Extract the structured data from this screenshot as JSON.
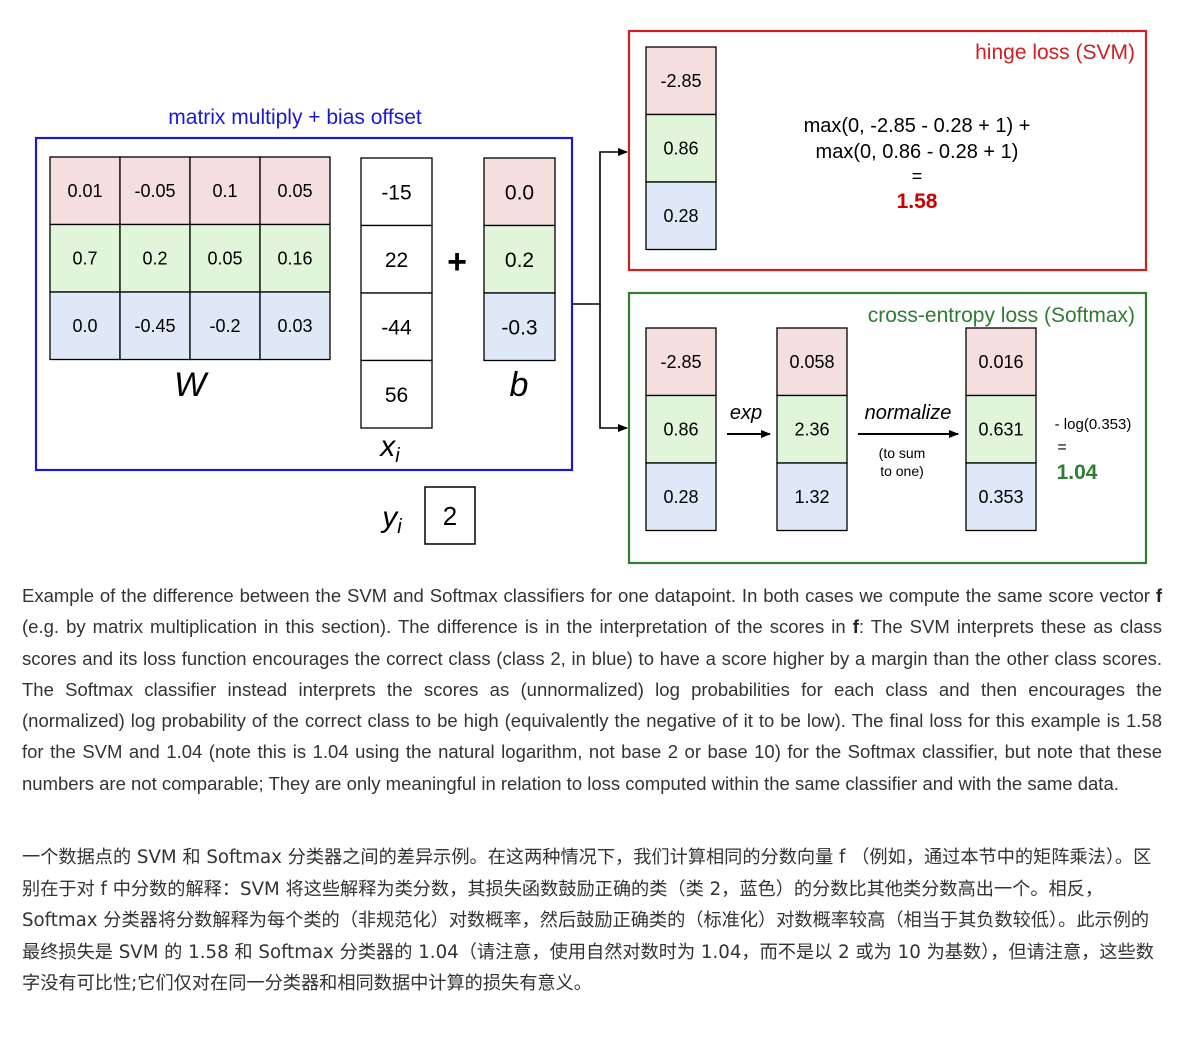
{
  "colors": {
    "row_red": "#f4dfde",
    "row_green": "#e0f5da",
    "row_blue": "#dfe8f7",
    "matrix_box": "#1a1ad6",
    "svm_box": "#d01e23",
    "softmax_box": "#2e7d32",
    "svm_result": "#cc0000",
    "softmax_result": "#2e7d32",
    "label_blue": "#1a1ad6",
    "label_red": "#d01e23",
    "label_green": "#2e7d32"
  },
  "matrix": {
    "label": "matrix multiply + bias offset",
    "W": [
      [
        "0.01",
        "-0.05",
        "0.1",
        "0.05"
      ],
      [
        "0.7",
        "0.2",
        "0.05",
        "0.16"
      ],
      [
        "0.0",
        "-0.45",
        "-0.2",
        "0.03"
      ]
    ],
    "W_label": "W",
    "x": [
      "-15",
      "22",
      "-44",
      "56"
    ],
    "x_label": "x",
    "x_sub": "i",
    "plus": "+",
    "b": [
      "0.0",
      "0.2",
      "-0.3"
    ],
    "b_label": "b",
    "y_label": "y",
    "y_sub": "i",
    "y_value": "2"
  },
  "svm": {
    "title": "hinge loss (SVM)",
    "scores": [
      "-2.85",
      "0.86",
      "0.28"
    ],
    "line1": "max(0, -2.85 - 0.28 + 1) +",
    "line2": "max(0, 0.86 - 0.28 + 1)",
    "equals": "=",
    "result": "1.58"
  },
  "softmax": {
    "title": "cross-entropy loss (Softmax)",
    "scores": [
      "-2.85",
      "0.86",
      "0.28"
    ],
    "exp_label": "exp",
    "exp_scores": [
      "0.058",
      "2.36",
      "1.32"
    ],
    "normalize_label": "normalize",
    "normalize_note1": "(to sum",
    "normalize_note2": "to one)",
    "probs": [
      "0.016",
      "0.631",
      "0.353"
    ],
    "loss_expr": "- log(0.353)",
    "equals": "=",
    "result": "1.04"
  },
  "caption_en": {
    "p1": "Example of the difference between the SVM and Softmax classifiers for one datapoint. In both cases we compute the same score vector ",
    "f1": "f",
    "p2": " (e.g. by matrix multiplication in this section). The difference is in the interpretation of the scores in ",
    "f2": "f",
    "p3": ": The SVM interprets these as class scores and its loss function encourages the correct class (class 2, in blue) to have a score higher by a margin than the other class scores. The Softmax classifier instead interprets the scores as (unnormalized) log probabilities for each class and then encourages the (normalized) log probability of the correct class to be high (equivalently the negative of it to be low). The final loss for this example is 1.58 for the SVM and 1.04 (note this is 1.04 using the natural logarithm, not base 2 or base 10) for the Softmax classifier, but note that these numbers are not comparable; They are only meaningful in relation to loss computed within the same classifier and with the same data."
  },
  "caption_zh": "一个数据点的 SVM 和 Softmax 分类器之间的差异示例。在这两种情况下，我们计算相同的分数向量 f （例如，通过本节中的矩阵乘法）。区别在于对 f 中分数的解释：SVM 将这些解释为类分数，其损失函数鼓励正确的类（类 2，蓝色）的分数比其他类分数高出一个。相反，Softmax 分类器将分数解释为每个类的（非规范化）对数概率，然后鼓励正确类的（标准化）对数概率较高（相当于其负数较低）。此示例的最终损失是 SVM 的 1.58 和 Softmax 分类器的 1.04（请注意，使用自然对数时为 1.04，而不是以 2 或为 10 为基数），但请注意，这些数字没有可比性;它们仅对在同一分类器和相同数据中计算的损失有意义。"
}
